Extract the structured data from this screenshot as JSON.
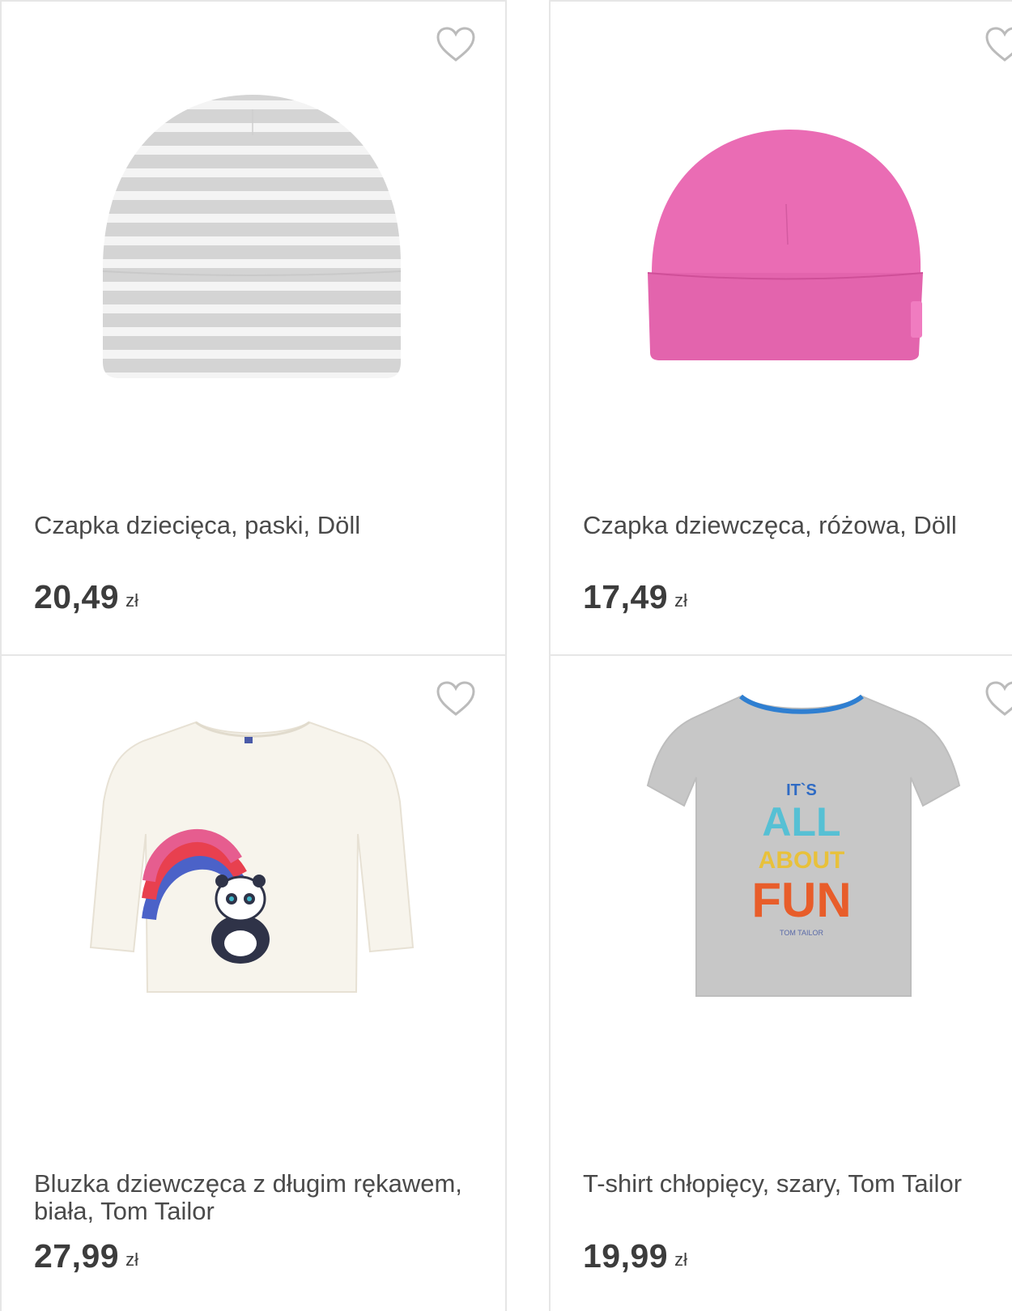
{
  "products": [
    {
      "title": "Czapka dziecięca, paski, Döll",
      "price": "20,49",
      "currency": "zł",
      "image_icon": "striped-hat-image",
      "favorite_icon": "heart-outline-icon"
    },
    {
      "title": "Czapka dziewczęca, różowa, Döll",
      "price": "17,49",
      "currency": "zł",
      "image_icon": "pink-hat-image",
      "favorite_icon": "heart-outline-icon"
    },
    {
      "title": "Bluzka dziewczęca z długim rękawem, biała, Tom Tailor",
      "price": "27,99",
      "currency": "zł",
      "image_icon": "white-longsleeve-panda-image",
      "favorite_icon": "heart-outline-icon"
    },
    {
      "title": "T-shirt chłopięcy, szary, Tom Tailor",
      "price": "19,99",
      "currency": "zł",
      "image_icon": "grey-tshirt-image",
      "favorite_icon": "heart-outline-icon",
      "print_lines": [
        "IT`S",
        "ALL",
        "ABOUT",
        "FUN",
        "TOM TAILOR"
      ]
    }
  ],
  "colors": {
    "border": "#e6e6e6",
    "text": "#4a4a4a",
    "price": "#3c3c3c",
    "heart": "#bbbbbb",
    "pink_hat": "#ea6cb4",
    "grey_stripe": "#d4d4d4"
  }
}
